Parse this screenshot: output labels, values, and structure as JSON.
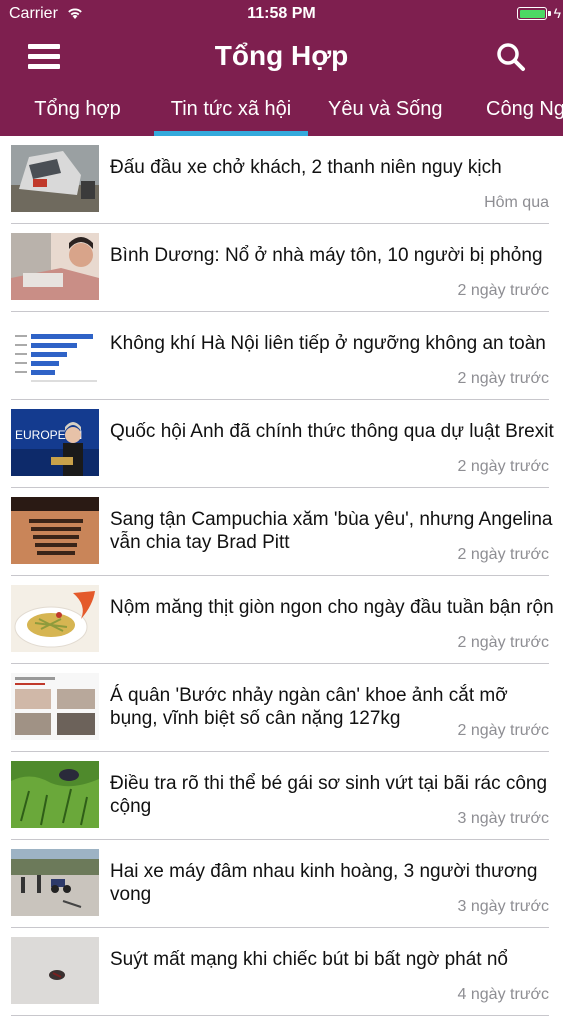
{
  "status_bar": {
    "carrier": "Carrier",
    "time": "11:58 PM"
  },
  "header": {
    "title": "Tổng Hợp",
    "menu_icon": "hamburger-icon",
    "search_icon": "search-icon",
    "accent": "#7e1f4f"
  },
  "tabs": [
    {
      "label": "Tổng hợp",
      "active": false
    },
    {
      "label": "Tin tức xã hội",
      "active": true
    },
    {
      "label": "Yêu và Sống",
      "active": false
    },
    {
      "label": "Công Ng",
      "active": false
    }
  ],
  "articles": [
    {
      "title": "Đấu đầu xe chở khách, 2 thanh niên nguy kịch",
      "time": "Hôm qua"
    },
    {
      "title": "Bình Dương: Nổ ở nhà máy tôn, 10 người bị phỏng",
      "time": "2 ngày trước"
    },
    {
      "title": "Không khí Hà Nội liên tiếp ở ngưỡng không an toàn",
      "time": "2 ngày trước"
    },
    {
      "title": "Quốc hội Anh đã chính thức thông qua dự luật Brexit",
      "time": "2 ngày trước",
      "thumb_text": "EUROPEAN"
    },
    {
      "title": "Sang tận Campuchia xăm 'bùa yêu', nhưng Angelina vẫn chia tay Brad Pitt",
      "time": "2 ngày trước"
    },
    {
      "title": "Nộm măng thịt giòn ngon cho ngày đầu tuần bận rộn",
      "time": "2 ngày trước"
    },
    {
      "title": "Á quân 'Bước nhảy ngàn cân' khoe ảnh cắt mỡ bụng, vĩnh biệt số cân nặng 127kg",
      "time": "2 ngày trước"
    },
    {
      "title": "Điều tra rõ thi thể bé gái sơ sinh vứt tại bãi rác công cộng",
      "time": "3 ngày trước"
    },
    {
      "title": "Hai xe máy đâm nhau kinh hoàng, 3 người thương vong",
      "time": "3 ngày trước"
    },
    {
      "title": "Suýt mất mạng khi chiếc bút bi bất ngờ phát nổ",
      "time": "4 ngày trước"
    }
  ]
}
